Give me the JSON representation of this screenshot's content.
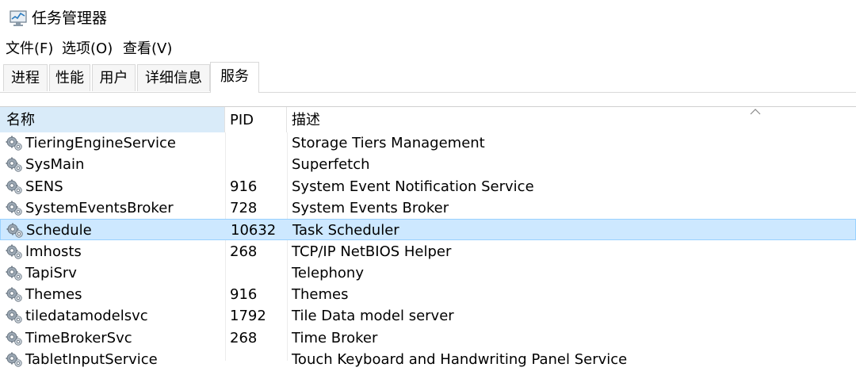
{
  "window": {
    "title": "任务管理器"
  },
  "menu": [
    "文件(F)",
    "选项(O)",
    "查看(V)"
  ],
  "tabs": [
    {
      "label": "进程"
    },
    {
      "label": "性能"
    },
    {
      "label": "用户"
    },
    {
      "label": "详细信息"
    },
    {
      "label": "服务",
      "active": true
    }
  ],
  "table": {
    "columns": [
      "名称",
      "PID",
      "描述"
    ],
    "rows": [
      {
        "name": "TieringEngineService",
        "pid": "",
        "desc": "Storage Tiers Management"
      },
      {
        "name": "SysMain",
        "pid": "",
        "desc": "Superfetch"
      },
      {
        "name": "SENS",
        "pid": "916",
        "desc": "System Event Notification Service"
      },
      {
        "name": "SystemEventsBroker",
        "pid": "728",
        "desc": "System Events Broker"
      },
      {
        "name": "Schedule",
        "pid": "10632",
        "desc": "Task Scheduler",
        "selected": true
      },
      {
        "name": "lmhosts",
        "pid": "268",
        "desc": "TCP/IP NetBIOS Helper"
      },
      {
        "name": "TapiSrv",
        "pid": "",
        "desc": "Telephony"
      },
      {
        "name": "Themes",
        "pid": "916",
        "desc": "Themes"
      },
      {
        "name": "tiledatamodelsvc",
        "pid": "1792",
        "desc": "Tile Data model server"
      },
      {
        "name": "TimeBrokerSvc",
        "pid": "268",
        "desc": "Time Broker"
      },
      {
        "name": "TabletInputService",
        "pid": "",
        "desc": "Touch Keyboard and Handwriting Panel Service"
      }
    ]
  },
  "colors": {
    "header_sort": "#d9ebf9",
    "selected_row": "#cde8ff",
    "selected_border": "#99d1ff"
  },
  "icons": {
    "app": "task-manager-icon",
    "service": "gear-icon",
    "sort": "sort-up-icon"
  }
}
